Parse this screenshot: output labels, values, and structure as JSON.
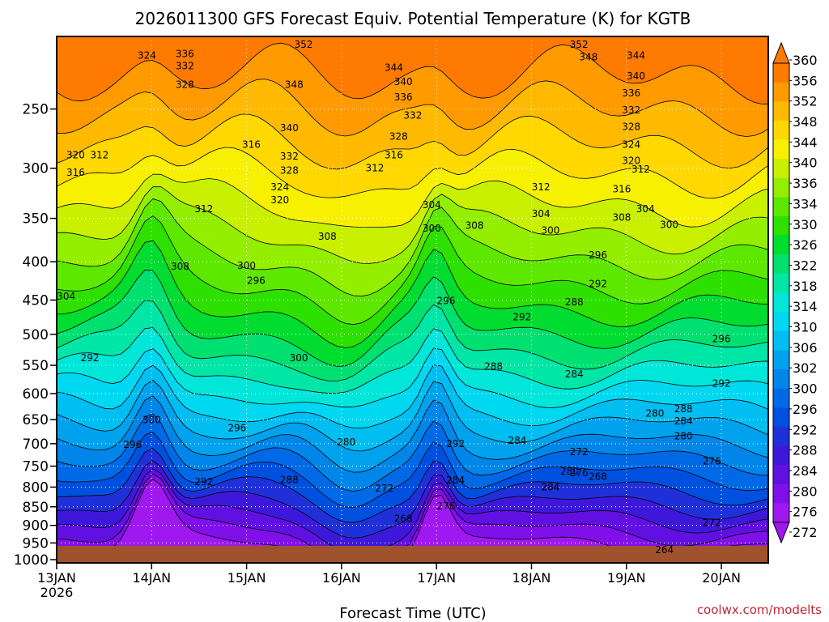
{
  "chart_data": {
    "type": "heatmap",
    "title": "2026011300 GFS Forecast Equiv. Potential Temperature (K) for KGTB",
    "xlabel": "Forecast Time (UTC)",
    "ylabel": "",
    "x_ticks": [
      "13JAN",
      "14JAN",
      "15JAN",
      "16JAN",
      "17JAN",
      "18JAN",
      "19JAN",
      "20JAN"
    ],
    "x_first_year": "2026",
    "x_range_days": [
      0,
      7.6
    ],
    "y_ticks": [
      250,
      300,
      350,
      400,
      450,
      500,
      550,
      600,
      650,
      700,
      750,
      800,
      850,
      900,
      950,
      1000
    ],
    "y_range_hpa": [
      200,
      1010
    ],
    "y_scale": "log",
    "grid": true,
    "colorbar": {
      "min": 272,
      "max": 360,
      "labels": [
        360,
        356,
        352,
        348,
        344,
        340,
        336,
        334,
        330,
        326,
        322,
        318,
        314,
        310,
        306,
        302,
        300,
        296,
        292,
        288,
        284,
        280,
        276,
        272
      ],
      "colors": [
        "#ff7a00",
        "#ff9a00",
        "#ffba00",
        "#ffd800",
        "#f7f000",
        "#c8f000",
        "#94ee00",
        "#5ee800",
        "#2ee000",
        "#00dc30",
        "#00e070",
        "#00e6a6",
        "#00e6d8",
        "#00d8f2",
        "#00bef2",
        "#00a2ee",
        "#0086e8",
        "#006ae6",
        "#0050e0",
        "#2030d8",
        "#3e18da",
        "#6010e0",
        "#8010ea",
        "#9f18f0"
      ]
    },
    "contour_labels": [
      {
        "value": 352,
        "x_day": 2.6,
        "p": 205
      },
      {
        "value": 352,
        "x_day": 5.5,
        "p": 205
      },
      {
        "value": 348,
        "x_day": 5.6,
        "p": 213
      },
      {
        "value": 348,
        "x_day": 2.5,
        "p": 232
      },
      {
        "value": 344,
        "x_day": 3.55,
        "p": 220
      },
      {
        "value": 344,
        "x_day": 6.1,
        "p": 212
      },
      {
        "value": 340,
        "x_day": 3.65,
        "p": 230
      },
      {
        "value": 340,
        "x_day": 6.1,
        "p": 226
      },
      {
        "value": 340,
        "x_day": 2.45,
        "p": 265
      },
      {
        "value": 336,
        "x_day": 1.35,
        "p": 211
      },
      {
        "value": 336,
        "x_day": 3.65,
        "p": 241
      },
      {
        "value": 336,
        "x_day": 6.05,
        "p": 238
      },
      {
        "value": 332,
        "x_day": 1.35,
        "p": 219
      },
      {
        "value": 332,
        "x_day": 3.75,
        "p": 255
      },
      {
        "value": 332,
        "x_day": 6.05,
        "p": 251
      },
      {
        "value": 332,
        "x_day": 2.45,
        "p": 289
      },
      {
        "value": 328,
        "x_day": 1.35,
        "p": 232
      },
      {
        "value": 328,
        "x_day": 3.6,
        "p": 272
      },
      {
        "value": 328,
        "x_day": 6.05,
        "p": 264
      },
      {
        "value": 328,
        "x_day": 2.45,
        "p": 302
      },
      {
        "value": 324,
        "x_day": 0.95,
        "p": 212
      },
      {
        "value": 324,
        "x_day": 6.05,
        "p": 279
      },
      {
        "value": 324,
        "x_day": 2.35,
        "p": 318
      },
      {
        "value": 320,
        "x_day": 0.2,
        "p": 288
      },
      {
        "value": 320,
        "x_day": 6.05,
        "p": 293
      },
      {
        "value": 320,
        "x_day": 2.35,
        "p": 331
      },
      {
        "value": 316,
        "x_day": 2.05,
        "p": 279
      },
      {
        "value": 316,
        "x_day": 3.55,
        "p": 288
      },
      {
        "value": 316,
        "x_day": 0.2,
        "p": 304
      },
      {
        "value": 316,
        "x_day": 5.95,
        "p": 320
      },
      {
        "value": 312,
        "x_day": 0.45,
        "p": 288
      },
      {
        "value": 312,
        "x_day": 3.35,
        "p": 300
      },
      {
        "value": 312,
        "x_day": 6.15,
        "p": 301
      },
      {
        "value": 312,
        "x_day": 5.1,
        "p": 318
      },
      {
        "value": 312,
        "x_day": 1.55,
        "p": 340
      },
      {
        "value": 308,
        "x_day": 2.85,
        "p": 370
      },
      {
        "value": 308,
        "x_day": 4.4,
        "p": 358
      },
      {
        "value": 308,
        "x_day": 5.95,
        "p": 349
      },
      {
        "value": 308,
        "x_day": 1.3,
        "p": 406
      },
      {
        "value": 304,
        "x_day": 3.95,
        "p": 336
      },
      {
        "value": 304,
        "x_day": 5.1,
        "p": 345
      },
      {
        "value": 304,
        "x_day": 6.2,
        "p": 340
      },
      {
        "value": 304,
        "x_day": 0.1,
        "p": 445
      },
      {
        "value": 300,
        "x_day": 3.95,
        "p": 361
      },
      {
        "value": 300,
        "x_day": 5.2,
        "p": 363
      },
      {
        "value": 300,
        "x_day": 6.45,
        "p": 357
      },
      {
        "value": 300,
        "x_day": 2.0,
        "p": 405
      },
      {
        "value": 300,
        "x_day": 2.55,
        "p": 538
      },
      {
        "value": 300,
        "x_day": 1.0,
        "p": 651
      },
      {
        "value": 296,
        "x_day": 5.7,
        "p": 392
      },
      {
        "value": 296,
        "x_day": 2.1,
        "p": 424
      },
      {
        "value": 296,
        "x_day": 4.1,
        "p": 451
      },
      {
        "value": 296,
        "x_day": 1.9,
        "p": 667
      },
      {
        "value": 296,
        "x_day": 0.8,
        "p": 702
      },
      {
        "value": 296,
        "x_day": 7.0,
        "p": 507
      },
      {
        "value": 292,
        "x_day": 5.7,
        "p": 428
      },
      {
        "value": 292,
        "x_day": 4.9,
        "p": 474
      },
      {
        "value": 292,
        "x_day": 0.35,
        "p": 538
      },
      {
        "value": 292,
        "x_day": 7.0,
        "p": 582
      },
      {
        "value": 292,
        "x_day": 4.2,
        "p": 700
      },
      {
        "value": 292,
        "x_day": 1.55,
        "p": 787
      },
      {
        "value": 288,
        "x_day": 5.45,
        "p": 453
      },
      {
        "value": 288,
        "x_day": 4.6,
        "p": 552
      },
      {
        "value": 288,
        "x_day": 6.6,
        "p": 629
      },
      {
        "value": 288,
        "x_day": 2.45,
        "p": 782
      },
      {
        "value": 284,
        "x_day": 5.45,
        "p": 565
      },
      {
        "value": 284,
        "x_day": 6.6,
        "p": 653
      },
      {
        "value": 284,
        "x_day": 4.85,
        "p": 693
      },
      {
        "value": 284,
        "x_day": 5.2,
        "p": 800
      },
      {
        "value": 284,
        "x_day": 4.2,
        "p": 783
      },
      {
        "value": 280,
        "x_day": 6.3,
        "p": 638
      },
      {
        "value": 280,
        "x_day": 6.6,
        "p": 684
      },
      {
        "value": 280,
        "x_day": 3.05,
        "p": 697
      },
      {
        "value": 280,
        "x_day": 5.4,
        "p": 762
      },
      {
        "value": 276,
        "x_day": 5.5,
        "p": 766
      },
      {
        "value": 276,
        "x_day": 6.9,
        "p": 739
      },
      {
        "value": 276,
        "x_day": 4.1,
        "p": 848
      },
      {
        "value": 272,
        "x_day": 5.5,
        "p": 718
      },
      {
        "value": 272,
        "x_day": 3.45,
        "p": 803
      },
      {
        "value": 272,
        "x_day": 6.9,
        "p": 893
      },
      {
        "value": 268,
        "x_day": 5.7,
        "p": 775
      },
      {
        "value": 268,
        "x_day": 3.65,
        "p": 882
      },
      {
        "value": 264,
        "x_day": 6.4,
        "p": 970
      }
    ]
  },
  "footer": {
    "credit": "coolwx.com/modelts"
  }
}
